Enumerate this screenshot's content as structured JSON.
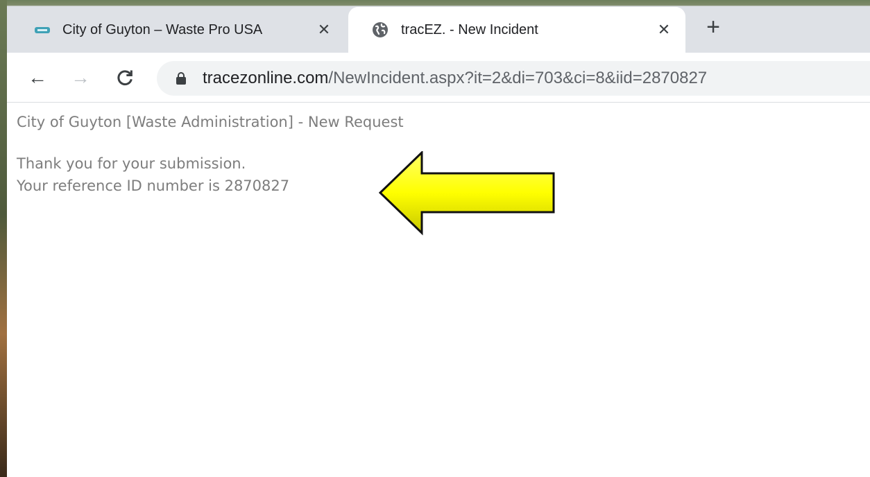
{
  "browser": {
    "tabs": [
      {
        "title": "City of Guyton – Waste Pro USA",
        "favicon": "card-icon",
        "active": false
      },
      {
        "title": "tracEZ. - New Incident",
        "favicon": "globe-icon",
        "active": true
      }
    ],
    "close_glyph": "✕",
    "new_tab_glyph": "+",
    "nav": {
      "back_glyph": "←",
      "forward_glyph": "→",
      "reload_glyph": "C"
    },
    "address": {
      "host": "tracezonline.com",
      "path": "/NewIncident.aspx?it=2&di=703&ci=8&iid=2870827"
    }
  },
  "page": {
    "heading": "City of Guyton [Waste Administration] - New Request",
    "message_line1": "Thank you for your submission.",
    "message_line2": "Your reference ID number is 2870827"
  },
  "annotation": {
    "icon": "arrow-left-icon",
    "color": "#ffff00"
  }
}
